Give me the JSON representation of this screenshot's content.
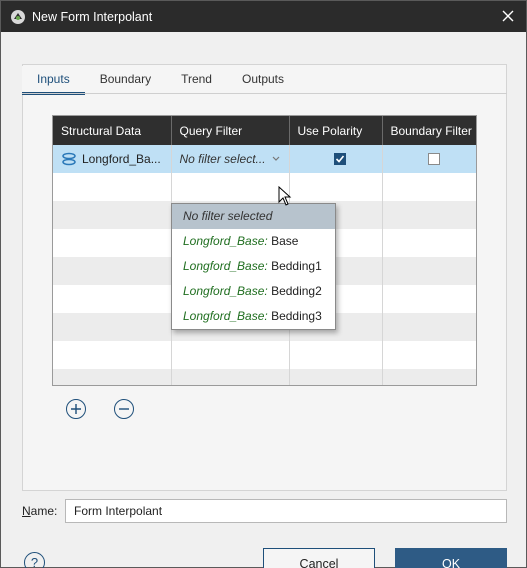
{
  "window": {
    "title": "New Form Interpolant",
    "close_icon": "close-icon",
    "app_icon": "leapfrog-app-icon"
  },
  "tabs": [
    {
      "label": "Inputs",
      "active": true
    },
    {
      "label": "Boundary",
      "active": false
    },
    {
      "label": "Trend",
      "active": false
    },
    {
      "label": "Outputs",
      "active": false
    }
  ],
  "grid": {
    "columns": [
      "Structural Data",
      "Query Filter",
      "Use Polarity",
      "Boundary Filter"
    ],
    "rows": [
      {
        "structural_data": "Longford_Ba...",
        "query_filter": "No filter select...",
        "use_polarity": true,
        "boundary_filter": false
      }
    ]
  },
  "dropdown": {
    "items": [
      {
        "prefix": "",
        "label": "No filter selected"
      },
      {
        "prefix": "Longford_Base:",
        "label": " Base"
      },
      {
        "prefix": "Longford_Base:",
        "label": " Bedding1"
      },
      {
        "prefix": "Longford_Base:",
        "label": " Bedding2"
      },
      {
        "prefix": "Longford_Base:",
        "label": " Bedding3"
      }
    ]
  },
  "name": {
    "label_prefix": "N",
    "label_rest": "ame:",
    "value": "Form Interpolant"
  },
  "buttons": {
    "cancel_u": "C",
    "cancel_rest": "ancel",
    "ok_u": "O",
    "ok_rest": "K",
    "help": "?"
  },
  "colors": {
    "accent": "#1e4f7a",
    "header_bg": "#2f2f2f",
    "selected_row": "#bfe0f5",
    "ok_bg": "#2e5b85",
    "green_text": "#1f6e1f"
  }
}
